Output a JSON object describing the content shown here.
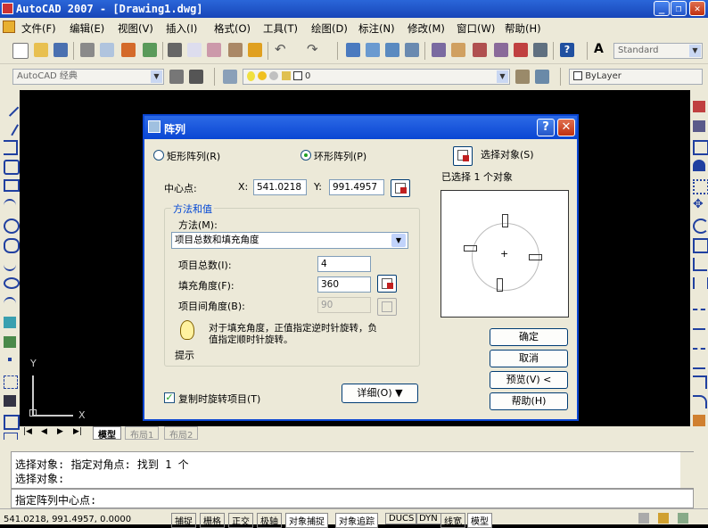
{
  "window": {
    "title": "AutoCAD 2007 - [Drawing1.dwg]"
  },
  "menu": [
    "文件(F)",
    "编辑(E)",
    "视图(V)",
    "插入(I)",
    "格式(O)",
    "工具(T)",
    "绘图(D)",
    "标注(N)",
    "修改(M)",
    "窗口(W)",
    "帮助(H)"
  ],
  "toolbar": {
    "text_style": "Standard",
    "workspace": "AutoCAD 经典",
    "layer": "0",
    "color": "ByLayer"
  },
  "tabs": [
    "模型",
    "布局1",
    "布局2"
  ],
  "ucs": {
    "x": "X",
    "y": "Y"
  },
  "dialog": {
    "title": "阵列",
    "help_glyph": "?",
    "close_glyph": "✕",
    "rect_array": "矩形阵列(R)",
    "polar_array": "环形阵列(P)",
    "center_label": "中心点:",
    "x_label": "X:",
    "x_value": "541.0218",
    "y_label": "Y:",
    "y_value": "991.4957",
    "method_group": "方法和值",
    "method_label": "方法(M):",
    "method_value": "项目总数和填充角度",
    "total_label": "项目总数(I):",
    "total_value": "4",
    "fill_label": "填充角度(F):",
    "fill_value": "360",
    "between_label": "项目间角度(B):",
    "between_value": "90",
    "tip_text_1": "对于填充角度，正值指定逆时针旋转，负",
    "tip_text_2": "值指定顺时针旋转。",
    "tip_label": "提示",
    "rotate_items": "复制时旋转项目(T)",
    "details": "详细(O) ▼",
    "select_objects": "选择对象(S)",
    "selected_count": "已选择 1 个对象",
    "ok": "确定",
    "cancel": "取消",
    "preview": "预览(V) <",
    "help": "帮助(H)"
  },
  "command": {
    "line1": "选择对象: 指定对角点: 找到 1 个",
    "line2": "选择对象:",
    "prompt": "指定阵列中心点:"
  },
  "status": {
    "coords": "541.0218, 991.4957, 0.0000",
    "buttons": [
      "捕捉",
      "栅格",
      "正交",
      "极轴",
      "对象捕捉",
      "对象追踪",
      "DUCS",
      "DYN",
      "线宽",
      "模型"
    ]
  }
}
